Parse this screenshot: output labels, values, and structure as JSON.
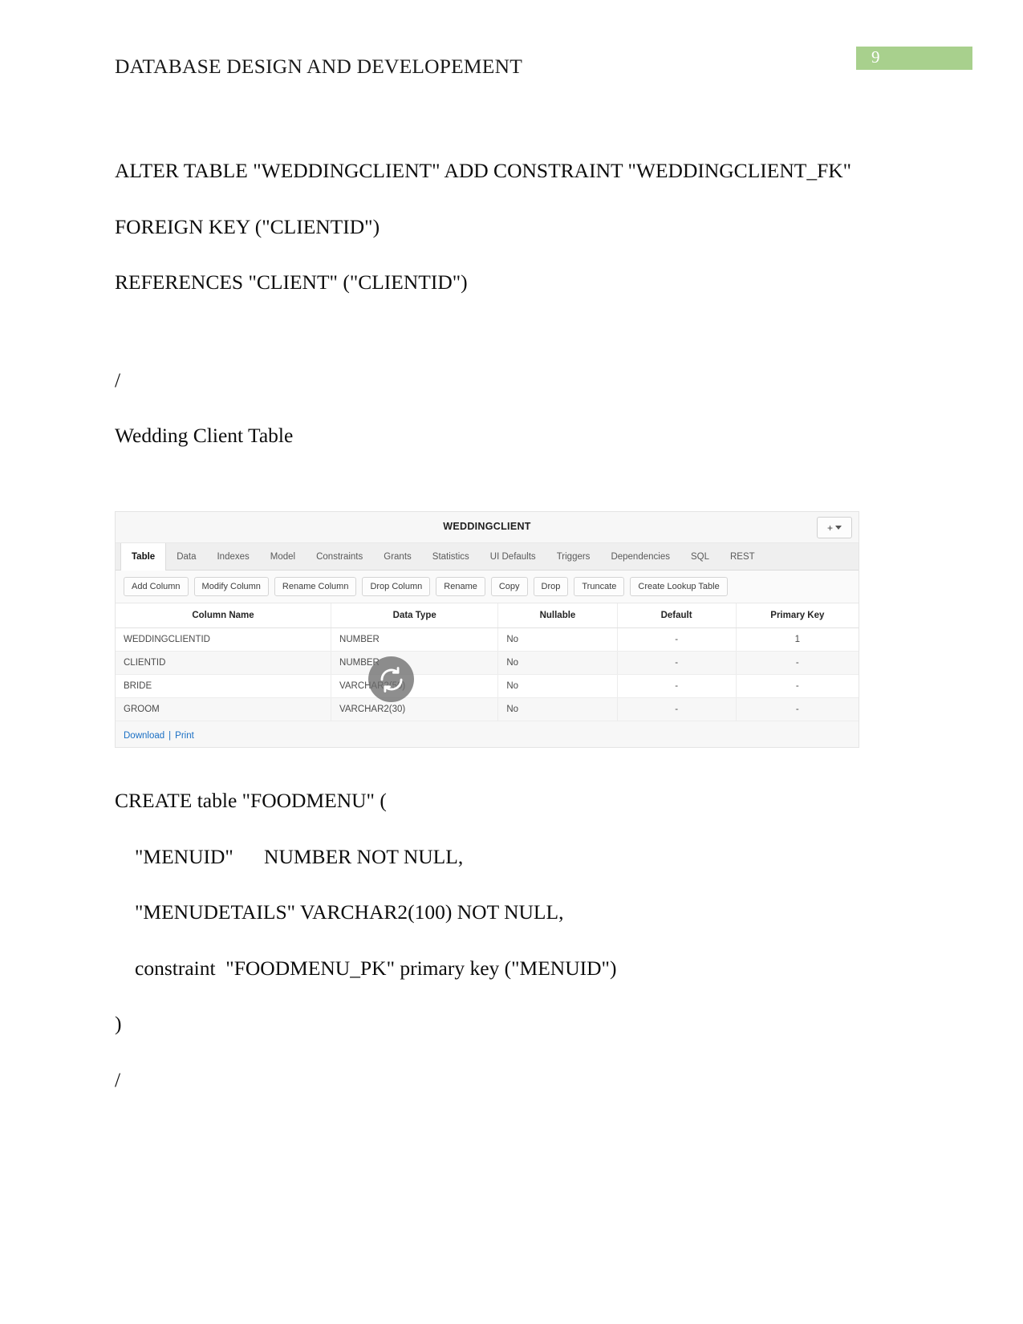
{
  "header": {
    "document_title": "DATABASE DESIGN AND DEVELOPEMENT",
    "page_number": "9",
    "page_number_bg": "#a8d08d"
  },
  "body_blocks": {
    "alter_table": "ALTER TABLE \"WEDDINGCLIENT\" ADD CONSTRAINT \"WEDDINGCLIENT_FK\"",
    "foreign_key": "FOREIGN KEY (\"CLIENTID\")",
    "references": "REFERENCES \"CLIENT\" (\"CLIENTID\")",
    "slash_1": "/",
    "caption": "Wedding Client Table",
    "create_table": "CREATE table \"FOODMENU\" (",
    "col_menuid": "\"MENUID\"      NUMBER NOT NULL,",
    "col_menudetails": "\"MENUDETAILS\" VARCHAR2(100) NOT NULL,",
    "constraint_pk": "constraint  \"FOODMENU_PK\" primary key (\"MENUID\")",
    "close_paren": ")",
    "slash_2": "/"
  },
  "app_screenshot": {
    "title": "WEDDINGCLIENT",
    "add_button_label": "+",
    "tabs": [
      {
        "label": "Table",
        "active": true
      },
      {
        "label": "Data",
        "active": false
      },
      {
        "label": "Indexes",
        "active": false
      },
      {
        "label": "Model",
        "active": false
      },
      {
        "label": "Constraints",
        "active": false
      },
      {
        "label": "Grants",
        "active": false
      },
      {
        "label": "Statistics",
        "active": false
      },
      {
        "label": "UI Defaults",
        "active": false
      },
      {
        "label": "Triggers",
        "active": false
      },
      {
        "label": "Dependencies",
        "active": false
      },
      {
        "label": "SQL",
        "active": false
      },
      {
        "label": "REST",
        "active": false
      }
    ],
    "buttons": [
      "Add Column",
      "Modify Column",
      "Rename Column",
      "Drop Column",
      "Rename",
      "Copy",
      "Drop",
      "Truncate",
      "Create Lookup Table"
    ],
    "table": {
      "headers": [
        "Column Name",
        "Data Type",
        "Nullable",
        "Default",
        "Primary Key"
      ],
      "rows": [
        {
          "column_name": "WEDDINGCLIENTID",
          "data_type": "NUMBER",
          "nullable": "No",
          "default": "-",
          "primary_key": "1"
        },
        {
          "column_name": "CLIENTID",
          "data_type": "NUMBER",
          "nullable": "No",
          "default": "-",
          "primary_key": "-"
        },
        {
          "column_name": "BRIDE",
          "data_type": "VARCHAR2(50)",
          "nullable": "No",
          "default": "-",
          "primary_key": "-"
        },
        {
          "column_name": "GROOM",
          "data_type": "VARCHAR2(30)",
          "nullable": "No",
          "default": "-",
          "primary_key": "-"
        }
      ]
    },
    "footer": {
      "download_label": "Download",
      "separator": "|",
      "print_label": "Print",
      "link_color": "#1a6fc4"
    },
    "overlay_icon": "refresh-icon"
  }
}
